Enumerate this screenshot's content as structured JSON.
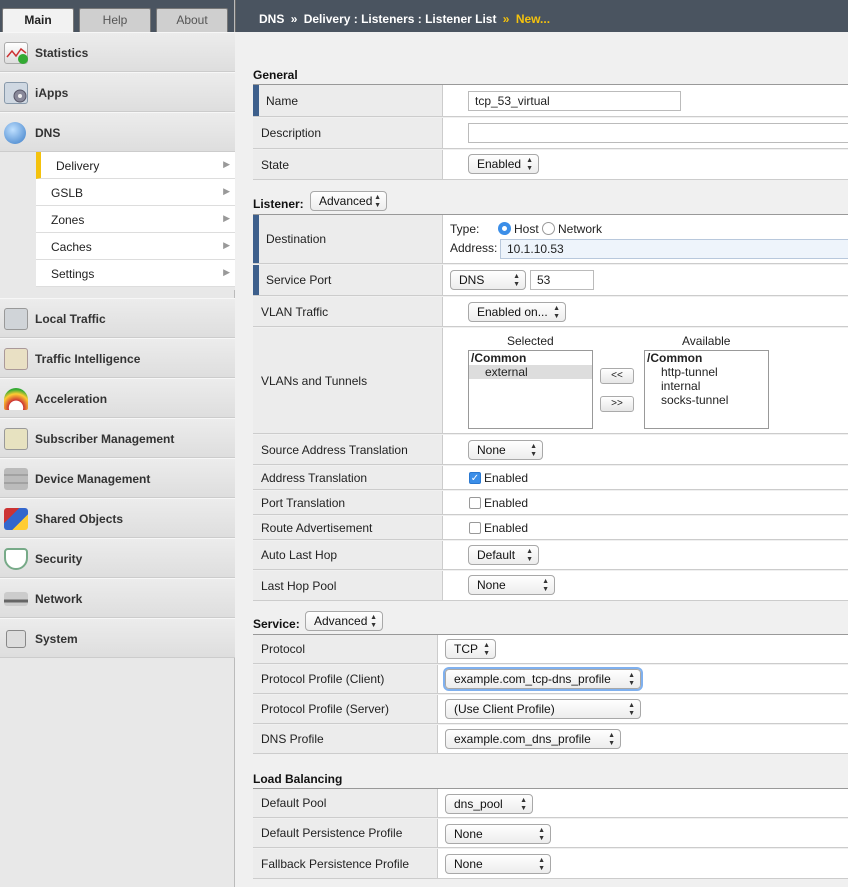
{
  "tabs": {
    "main": "Main",
    "help": "Help",
    "about": "About"
  },
  "breadcrumb": {
    "p1": "DNS",
    "sep1": "»",
    "p2": "Delivery : Listeners : Listener List",
    "sep2": "»",
    "p3": "New..."
  },
  "nav": {
    "statistics": "Statistics",
    "iapps": "iApps",
    "dns": "DNS",
    "dns_sub": [
      "Delivery",
      "GSLB",
      "Zones",
      "Caches",
      "Settings"
    ],
    "local_traffic": "Local Traffic",
    "traffic_intelligence": "Traffic Intelligence",
    "acceleration": "Acceleration",
    "subscriber_management": "Subscriber Management",
    "device_management": "Device Management",
    "shared_objects": "Shared Objects",
    "security": "Security",
    "network": "Network",
    "system": "System"
  },
  "general": {
    "title": "General",
    "name_label": "Name",
    "name_value": "tcp_53_virtual",
    "description_label": "Description",
    "description_value": "",
    "state_label": "State",
    "state_value": "Enabled"
  },
  "listener": {
    "title": "Listener:",
    "mode": "Advanced",
    "destination_label": "Destination",
    "type_label": "Type:",
    "type_host": "Host",
    "type_network": "Network",
    "address_label": "Address:",
    "address_value": "10.1.10.53",
    "service_port_label": "Service Port",
    "service_port_select": "DNS",
    "service_port_value": "53",
    "vlan_traffic_label": "VLAN Traffic",
    "vlan_traffic_value": "Enabled on...",
    "vlans_label": "VLANs and Tunnels",
    "selected_header": "Selected",
    "available_header": "Available",
    "selected_group": "/Common",
    "selected_items": [
      "external"
    ],
    "available_group": "/Common",
    "available_items": [
      "http-tunnel",
      "internal",
      "socks-tunnel"
    ],
    "move_left": "<<",
    "move_right": ">>",
    "source_translation_label": "Source Address Translation",
    "source_translation_value": "None",
    "address_translation_label": "Address Translation",
    "address_translation_text": "Enabled",
    "port_translation_label": "Port Translation",
    "port_translation_text": "Enabled",
    "route_advertisement_label": "Route Advertisement",
    "route_advertisement_text": "Enabled",
    "auto_last_hop_label": "Auto Last Hop",
    "auto_last_hop_value": "Default",
    "last_hop_pool_label": "Last Hop Pool",
    "last_hop_pool_value": "None"
  },
  "service": {
    "title": "Service:",
    "mode": "Advanced",
    "protocol_label": "Protocol",
    "protocol_value": "TCP",
    "profile_client_label": "Protocol Profile (Client)",
    "profile_client_value": "example.com_tcp-dns_profile",
    "profile_server_label": "Protocol Profile (Server)",
    "profile_server_value": "(Use Client Profile)",
    "dns_profile_label": "DNS Profile",
    "dns_profile_value": "example.com_dns_profile"
  },
  "load_balancing": {
    "title": "Load Balancing",
    "default_pool_label": "Default Pool",
    "default_pool_value": "dns_pool",
    "default_persistence_label": "Default Persistence Profile",
    "default_persistence_value": "None",
    "fallback_persistence_label": "Fallback Persistence Profile",
    "fallback_persistence_value": "None"
  },
  "colors": {
    "header_bg": "#4a5460",
    "accent": "#f4c20d",
    "required_bar": "#3d5f8c",
    "check": "#3b8ee8"
  }
}
